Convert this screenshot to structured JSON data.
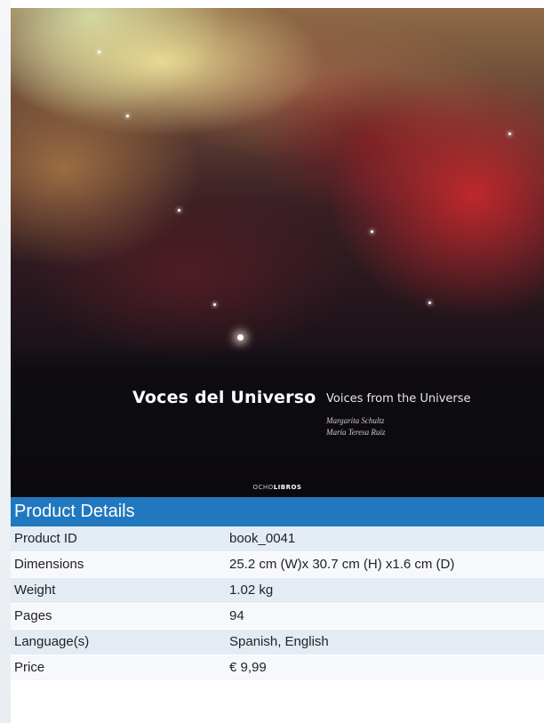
{
  "cover": {
    "title": "Voces del Universo",
    "subtitle": "Voices from the Universe",
    "authors": [
      "Margarita Schultz",
      "María Teresa Ruiz"
    ],
    "publisher_prefix": "OCHO",
    "publisher_suffix": "LIBROS"
  },
  "details": {
    "header": "Product Details",
    "rows": [
      {
        "label": "Product ID",
        "value": "book_0041"
      },
      {
        "label": "Dimensions",
        "value": "25.2 cm (W)x 30.7 cm (H) x1.6 cm (D)"
      },
      {
        "label": "Weight",
        "value": "1.02 kg"
      },
      {
        "label": "Pages",
        "value": "94"
      },
      {
        "label": "Language(s)",
        "value": "Spanish, English"
      },
      {
        "label": "Price",
        "value": "€ 9,99"
      }
    ]
  },
  "colors": {
    "header_bg": "#2178be",
    "row_odd": "#e3ecf5",
    "row_even": "#f6f8fb"
  }
}
